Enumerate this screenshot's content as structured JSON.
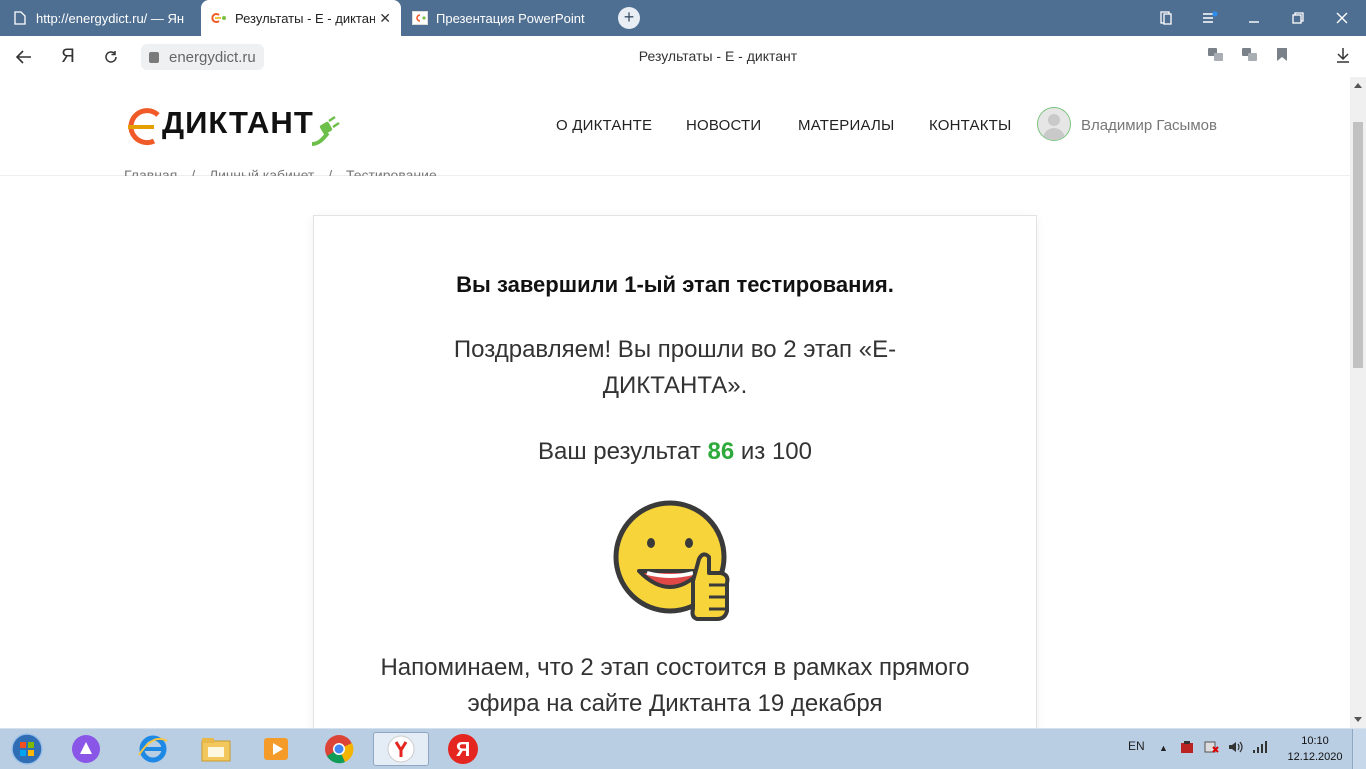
{
  "browser": {
    "tabs": [
      {
        "label": "http://energydict.ru/ — Ян",
        "icon": "page-icon"
      },
      {
        "label": "Результаты - Е - диктан",
        "icon": "site-favicon",
        "close": "✕"
      },
      {
        "label": "Презентация PowerPoint",
        "icon": "site-favicon"
      }
    ],
    "new_tab": "+",
    "url": "energydict.ru",
    "page_title": "Результаты - Е - диктант",
    "yandex_letter": "Я"
  },
  "site": {
    "logo_text": "ДИКТАНТ",
    "nav": [
      "О ДИКТАНТЕ",
      "НОВОСТИ",
      "МАТЕРИАЛЫ",
      "КОНТАКТЫ"
    ],
    "user_name": "Владимир Гасымов",
    "breadcrumbs": [
      "Главная",
      "/",
      "Личный кабинет",
      "/",
      "Тестирование"
    ]
  },
  "result": {
    "title": "Вы завершили 1-ый этап тестирования.",
    "congrats": "Поздравляем! Вы прошли во 2 этап «Е-ДИКТАНТА».",
    "score_prefix": "Ваш результат",
    "score": "86",
    "score_suffix": "из 100",
    "reminder": "Напоминаем, что 2 этап состоится в рамках прямого эфира на сайте Диктанта 19 декабря"
  },
  "taskbar": {
    "lang": "EN",
    "time": "10:10",
    "date": "12.12.2020"
  },
  "colors": {
    "tab_bar": "#4f6f92",
    "accent_green": "#2eaa3c",
    "logo_orange": "#f05a28",
    "taskbar": "#b9cde3"
  }
}
